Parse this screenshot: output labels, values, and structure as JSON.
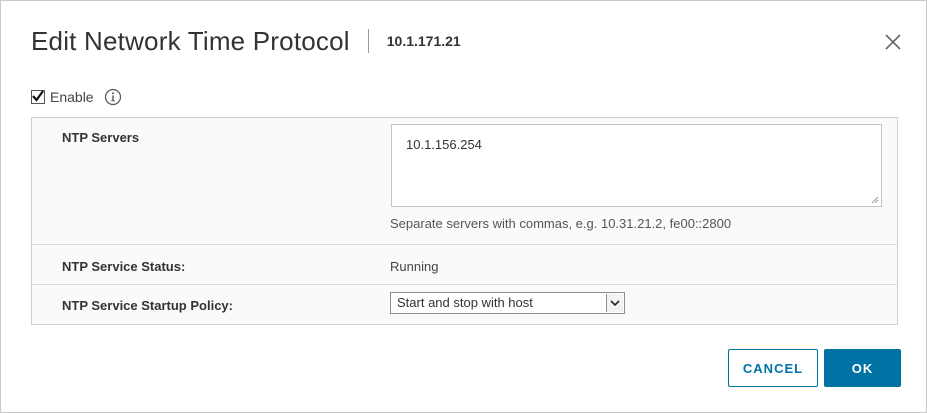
{
  "dialog": {
    "title": "Edit Network Time Protocol",
    "host": "10.1.171.21",
    "close_icon": "close-icon"
  },
  "enable": {
    "label": "Enable",
    "checked": true,
    "info_icon": "info-icon"
  },
  "settings": {
    "ntp_servers": {
      "label": "NTP Servers",
      "value": "10.1.156.254",
      "hint": "Separate servers with commas, e.g. 10.31.21.2, fe00::2800"
    },
    "service_status": {
      "label": "NTP Service Status:",
      "value": "Running"
    },
    "startup_policy": {
      "label": "NTP Service Startup Policy:",
      "selected": "Start and stop with host"
    }
  },
  "actions": {
    "cancel_label": "CANCEL",
    "ok_label": "OK"
  },
  "colors": {
    "primary": "#0072a3",
    "table_bg": "#fafafa",
    "border": "#cfcfcf"
  }
}
